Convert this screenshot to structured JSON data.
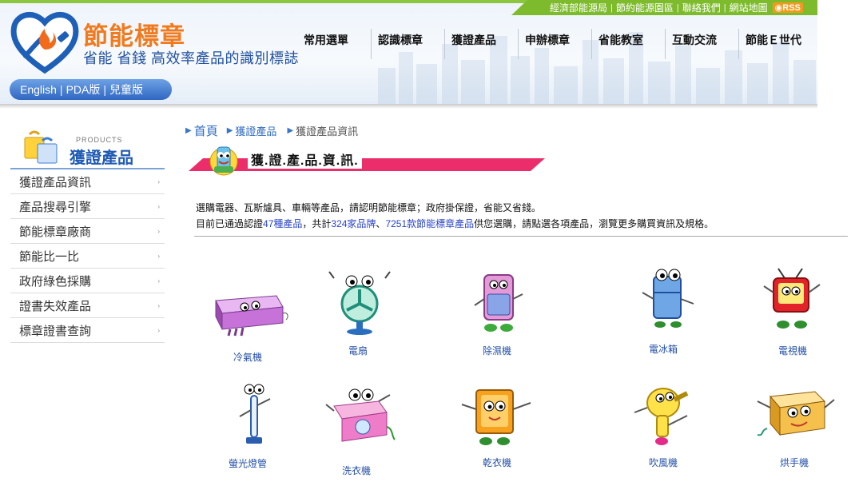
{
  "header": {
    "top_links": [
      "經濟部能源局",
      "節約能源園區",
      "聯絡我們",
      "網站地圖"
    ],
    "rss_label": "RSS",
    "brand_title": "節能標章",
    "brand_slogan": "省能 省錢 高效率產品的識別標誌",
    "lang_links": [
      "English",
      "PDA版",
      "兒童版"
    ],
    "nav": [
      "常用選單",
      "認識標章",
      "獲證產品",
      "申辦標章",
      "省能教室",
      "互動交流",
      "節能Ｅ世代"
    ]
  },
  "sidebar": {
    "head_en": "PRODUCTS",
    "head_zh": "獲證產品",
    "items": [
      "獲證產品資訊",
      "產品搜尋引擎",
      "節能標章廠商",
      "節能比一比",
      "政府綠色採購",
      "證書失效產品",
      "標章證書查詢"
    ],
    "arrow": "›"
  },
  "breadcrumb": {
    "home": "首頁",
    "category": "獲證產品",
    "current": "獲證產品資訊"
  },
  "banner_title": "獲.證.產.品.資.訊.",
  "intro": {
    "line1": "選購電器、瓦斯爐具、車輛等產品，請認明節能標章；政府掛保證，省能又省錢。",
    "line2_a": "目前已通過認證",
    "line2_link1": "47種產品",
    "line2_b": "，共計",
    "line2_link2": "324家品牌",
    "line2_c": "、",
    "line2_link3": "7251款節能標章產品",
    "line2_d": "供您選購，請點選各項產品，瀏覽更多購買資訊及規格。"
  },
  "products": [
    {
      "name": "冷氣機",
      "icon": "air-conditioner-icon"
    },
    {
      "name": "電扇",
      "icon": "electric-fan-icon"
    },
    {
      "name": "除濕機",
      "icon": "dehumidifier-icon"
    },
    {
      "name": "電冰箱",
      "icon": "refrigerator-icon"
    },
    {
      "name": "電視機",
      "icon": "television-icon"
    },
    {
      "name": "螢光燈管",
      "icon": "fluorescent-lamp-icon"
    },
    {
      "name": "洗衣機",
      "icon": "washing-machine-icon"
    },
    {
      "name": "乾衣機",
      "icon": "clothes-dryer-icon"
    },
    {
      "name": "吹風機",
      "icon": "hair-dryer-icon"
    },
    {
      "name": "烘手機",
      "icon": "hand-dryer-icon"
    }
  ],
  "colors": {
    "accent_green": "#7dbb2c",
    "brand_orange": "#f07a1e",
    "brand_blue": "#1f5bb5",
    "banner_pink": "#ec2d6b"
  }
}
